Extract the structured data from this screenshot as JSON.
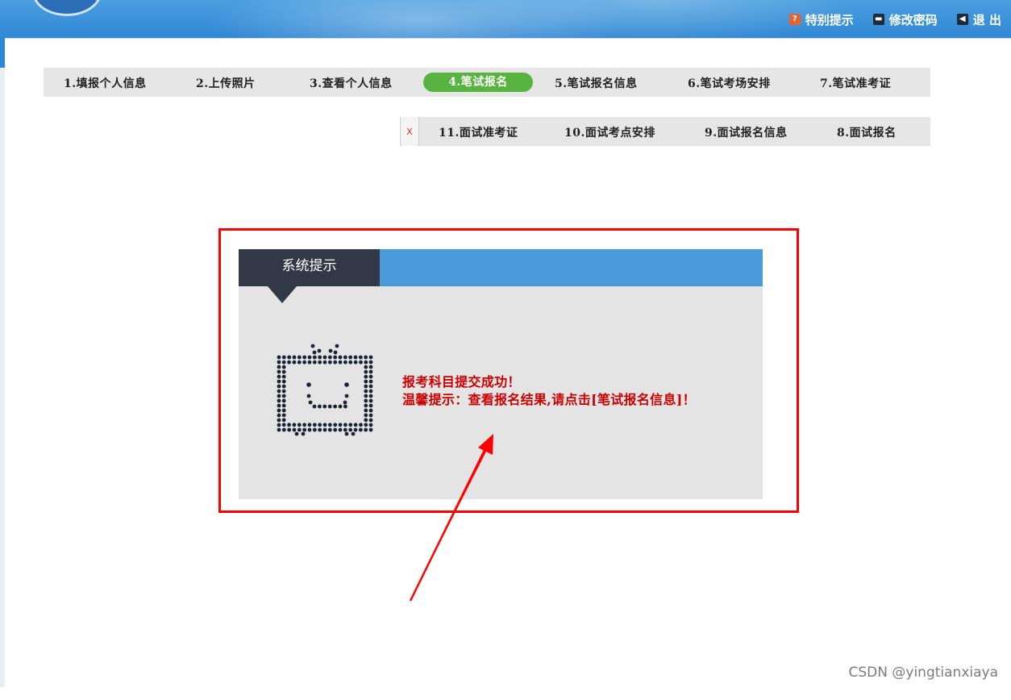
{
  "top_links": {
    "help": "特别提示",
    "password": "修改密码",
    "logout": "退 出"
  },
  "steps_row1": [
    "1.填报个人信息",
    "2.上传照片",
    "3.查看个人信息",
    "4.笔试报名",
    "5.笔试报名信息",
    "6.笔试考场安排",
    "7.笔试准考证"
  ],
  "steps_row2": [
    "11.面试准考证",
    "10.面试考点安排",
    "9.面试报名信息",
    "8.面试报名"
  ],
  "close_glyph": "X",
  "dialog": {
    "title": "系统提示",
    "line1": "报考科目提交成功！",
    "line2": "温馨提示：查看报名结果,请点击[笔试报名信息]！"
  },
  "watermark": "CSDN @yingtianxiaya",
  "colors": {
    "active_step": "#58b340",
    "dialog_header": "#4a9ad9",
    "dialog_tab": "#323846",
    "message": "#cc0000",
    "highlight": "#ff0000"
  }
}
